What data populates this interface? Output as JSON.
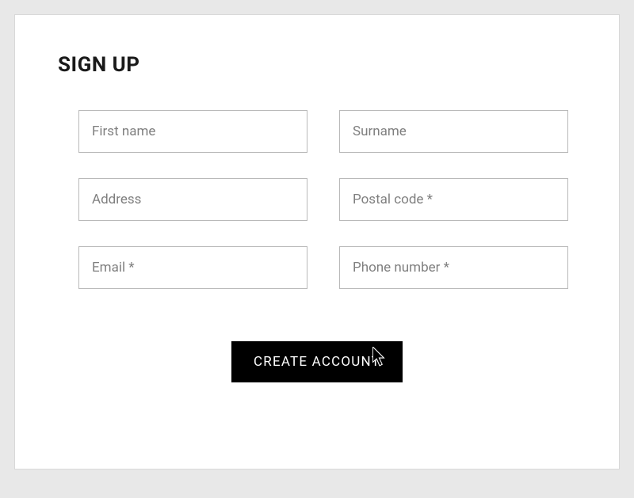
{
  "title": "SIGN UP",
  "fields": {
    "first_name": {
      "placeholder": "First name",
      "value": ""
    },
    "surname": {
      "placeholder": "Surname",
      "value": ""
    },
    "address": {
      "placeholder": "Address",
      "value": ""
    },
    "postal_code": {
      "placeholder": "Postal code *",
      "value": ""
    },
    "email": {
      "placeholder": "Email *",
      "value": ""
    },
    "phone": {
      "placeholder": "Phone number *",
      "value": ""
    }
  },
  "submit_label": "CREATE ACCOUNT"
}
